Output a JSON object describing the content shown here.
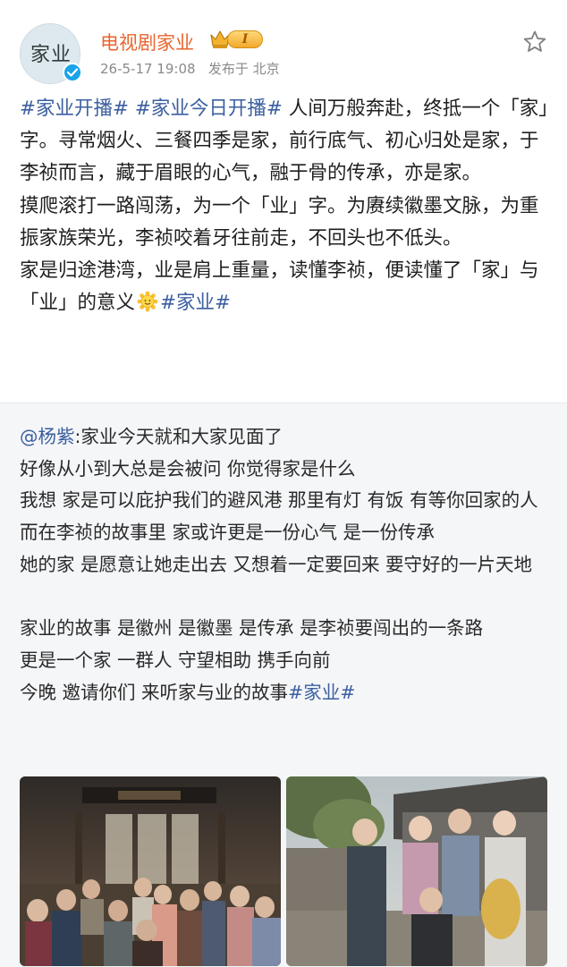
{
  "author": {
    "avatar_text": "家业",
    "name": "电视剧家业",
    "level_badge": "I",
    "timestamp": "26-5-17 19:08",
    "location": "发布于 北京"
  },
  "post": {
    "tag1": "#家业开播#",
    "tag2": "#家业今日开播#",
    "para1": "人间万般奔赴，终抵一个「家」字。寻常烟火、三餐四季是家，前行底气、初心归处是家，于李祯而言，藏于眉眼的心气，融于骨的传承，亦是家。",
    "para2": "摸爬滚打一路闯荡，为一个「业」字。为赓续徽墨文脉，为重振家族荣光，李祯咬着牙往前走，不回头也不低头。",
    "para3": "家是归途港湾，业是肩上重量，读懂李祯，便读懂了「家」与「业」的意义",
    "emoji": "sun-face",
    "tag3": "#家业#"
  },
  "repost": {
    "mention": "@杨紫",
    "line1": ":家业今天就和大家见面了",
    "line2": "好像从小到大总是会被问 你觉得家是什么",
    "line3": "我想 家是可以庇护我们的避风港 那里有灯 有饭 有等你回家的人",
    "line4": "而在李祯的故事里 家或许更是一份心气 是一份传承",
    "line5": "她的家 是愿意让她走出去 又想着一定要回来 要守好的一片天地",
    "line6": "家业的故事 是徽州 是徽墨 是传承 是李祯要闯出的一条路",
    "line7": "更是一个家 一群人 守望相助 携手向前",
    "line8": "今晚 邀请你们 来听家与业的故事",
    "tag": "#家业#"
  },
  "images": [
    "cast-group-photo",
    "cast-street-photo"
  ],
  "colors": {
    "author": "#e8652d",
    "link": "#3b5fa0",
    "repost_bg": "#f5f6f8",
    "verified": "#1aa3e8"
  }
}
